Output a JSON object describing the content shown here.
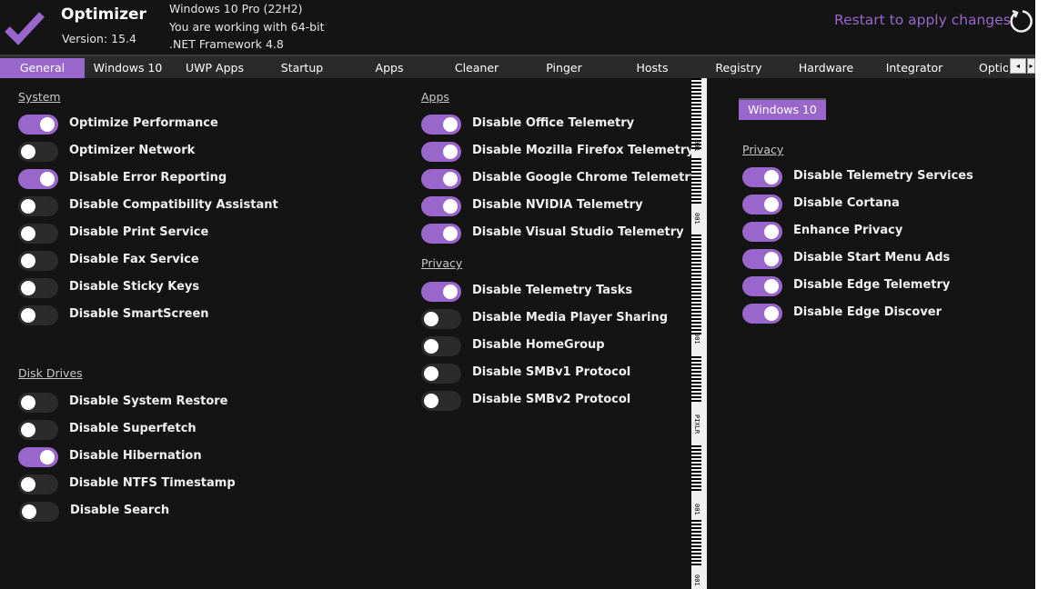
{
  "header": {
    "app_title": "Optimizer",
    "version": "Version: 15.4",
    "sysinfo": [
      "Windows 10 Pro (22H2)",
      "You are working with 64-bit",
      ".NET Framework 4.8"
    ],
    "restart_label": "Restart to apply changes",
    "logo_icon": "checkmark-icon",
    "restart_icon": "refresh-icon"
  },
  "colors": {
    "accent": "#9966cc",
    "background": "#141414",
    "tabbar": "#2a2a2a",
    "toggle_off": "#2b2b2b"
  },
  "tabs": [
    {
      "label": "General",
      "active": true
    },
    {
      "label": "Windows 10",
      "active": false
    },
    {
      "label": "UWP Apps",
      "active": false
    },
    {
      "label": "Startup",
      "active": false
    },
    {
      "label": "Apps",
      "active": false
    },
    {
      "label": "Cleaner",
      "active": false
    },
    {
      "label": "Pinger",
      "active": false
    },
    {
      "label": "Hosts",
      "active": false
    },
    {
      "label": "Registry",
      "active": false
    },
    {
      "label": "Hardware",
      "active": false
    },
    {
      "label": "Integrator",
      "active": false
    },
    {
      "label": "Optio",
      "active": false
    }
  ],
  "tab_scroll": {
    "left": "◂",
    "right": "▸"
  },
  "general": {
    "system": {
      "title": "System",
      "options": [
        {
          "label": "Optimize Performance",
          "on": true
        },
        {
          "label": "Optimizer Network",
          "on": false
        },
        {
          "label": "Disable Error Reporting",
          "on": true
        },
        {
          "label": "Disable Compatibility Assistant",
          "on": false
        },
        {
          "label": "Disable Print Service",
          "on": false
        },
        {
          "label": "Disable Fax Service",
          "on": false
        },
        {
          "label": "Disable Sticky Keys",
          "on": false
        },
        {
          "label": "Disable SmartScreen",
          "on": false
        }
      ]
    },
    "disk_drives": {
      "title": "Disk Drives",
      "options": [
        {
          "label": "Disable System Restore",
          "on": false
        },
        {
          "label": "Disable Superfetch",
          "on": false
        },
        {
          "label": "Disable Hibernation",
          "on": true
        },
        {
          "label": "Disable NTFS Timestamp",
          "on": false
        },
        {
          "label": "Disable Search",
          "on": false
        }
      ]
    },
    "apps": {
      "title": "Apps",
      "options": [
        {
          "label": "Disable Office Telemetry",
          "on": true
        },
        {
          "label": "Disable Mozilla Firefox Telemetry",
          "on": true
        },
        {
          "label": "Disable Google Chrome Telemetry",
          "on": true
        },
        {
          "label": "Disable NVIDIA Telemetry",
          "on": true
        },
        {
          "label": "Disable Visual Studio Telemetry",
          "on": true
        }
      ]
    },
    "privacy": {
      "title": "Privacy",
      "options": [
        {
          "label": "Disable Telemetry Tasks",
          "on": true
        },
        {
          "label": "Disable Media Player Sharing",
          "on": false
        },
        {
          "label": "Disable HomeGroup",
          "on": false
        },
        {
          "label": "Disable SMBv1 Protocol",
          "on": false
        },
        {
          "label": "Disable SMBv2 Protocol",
          "on": false
        }
      ]
    }
  },
  "ruler": {
    "marks": [
      "001",
      "001",
      "001",
      "PIXLR",
      "001",
      "001"
    ]
  },
  "windows10_panel": {
    "subtab_label": "Windows 10",
    "privacy": {
      "title": "Privacy",
      "options": [
        {
          "label": "Disable Telemetry Services",
          "on": true
        },
        {
          "label": "Disable Cortana",
          "on": true
        },
        {
          "label": "Enhance Privacy",
          "on": true
        },
        {
          "label": "Disable Start Menu Ads",
          "on": true
        },
        {
          "label": "Disable Edge Telemetry",
          "on": true
        },
        {
          "label": "Disable Edge Discover",
          "on": true
        }
      ]
    }
  }
}
